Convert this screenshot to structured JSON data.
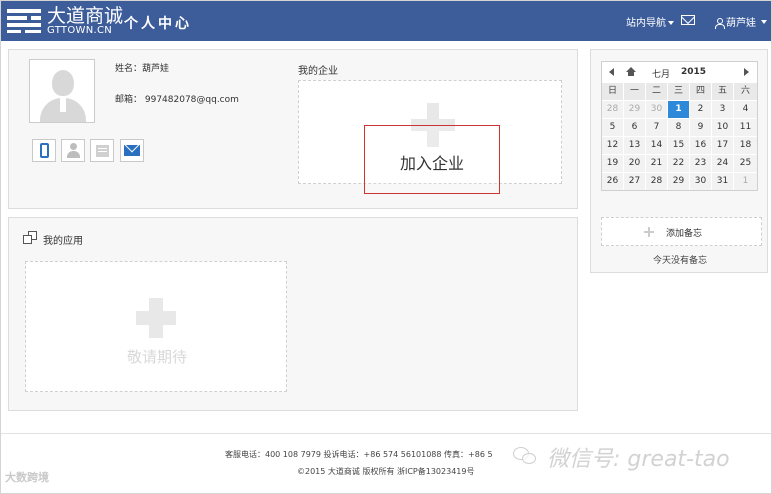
{
  "header": {
    "brand_cn": "大道商诚",
    "brand_en": "GTTOWN.CN",
    "title": "个人中心",
    "nav_label": "站内导航",
    "username": "葫芦娃"
  },
  "profile": {
    "name_line": "姓名：葫芦娃",
    "email_line": "邮箱： 997482078@qq.com"
  },
  "enterprise": {
    "label": "我的企业",
    "join_label": "加入企业"
  },
  "apps": {
    "label": "我的应用",
    "coming_soon": "敬请期待"
  },
  "calendar": {
    "month": "七月",
    "year": "2015",
    "weekdays": [
      "日",
      "一",
      "二",
      "三",
      "四",
      "五",
      "六"
    ],
    "weeks": [
      [
        {
          "d": "28",
          "m": true
        },
        {
          "d": "29",
          "m": true
        },
        {
          "d": "30",
          "m": true
        },
        {
          "d": "1",
          "t": true
        },
        {
          "d": "2"
        },
        {
          "d": "3"
        },
        {
          "d": "4"
        }
      ],
      [
        {
          "d": "5"
        },
        {
          "d": "6"
        },
        {
          "d": "7"
        },
        {
          "d": "8"
        },
        {
          "d": "9"
        },
        {
          "d": "10"
        },
        {
          "d": "11"
        }
      ],
      [
        {
          "d": "12"
        },
        {
          "d": "13"
        },
        {
          "d": "14"
        },
        {
          "d": "15"
        },
        {
          "d": "16"
        },
        {
          "d": "17"
        },
        {
          "d": "18"
        }
      ],
      [
        {
          "d": "19"
        },
        {
          "d": "20"
        },
        {
          "d": "21"
        },
        {
          "d": "22"
        },
        {
          "d": "23"
        },
        {
          "d": "24"
        },
        {
          "d": "25"
        }
      ],
      [
        {
          "d": "26"
        },
        {
          "d": "27"
        },
        {
          "d": "28"
        },
        {
          "d": "29"
        },
        {
          "d": "30"
        },
        {
          "d": "31"
        },
        {
          "d": "1",
          "m": true
        }
      ]
    ],
    "add_note": "添加备忘",
    "no_note": "今天没有备忘"
  },
  "footer": {
    "contacts": "客服电话：400 108 7979 投诉电话：+86 574 56101088 传真：+86 5",
    "copyright": "©2015 大道商诚 版权所有 浙ICP备13023419号"
  },
  "watermark": {
    "left": "大数跨境",
    "right": "微信号: great-tao"
  },
  "colors": {
    "header_bg": "#3c5d9a",
    "today_bg": "#2e8ad8",
    "join_border": "#cc3333"
  }
}
